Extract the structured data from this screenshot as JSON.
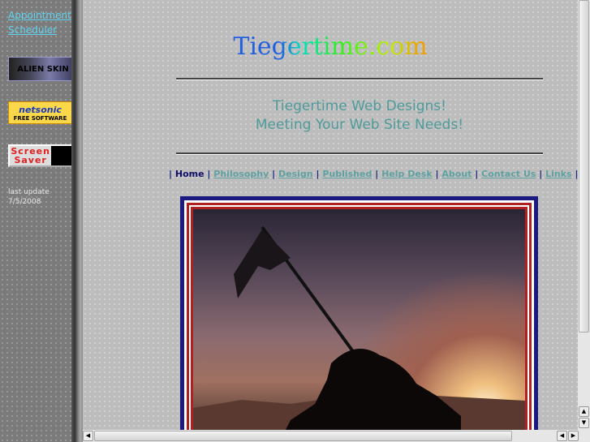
{
  "sidebar": {
    "appointment_link": "Appointment Scheduler",
    "alien_skin_label": "ALIEN SKIN",
    "netsonic_brand": "netsonic",
    "netsonic_sub": "FREE SOFTWARE",
    "screensaver_label": "Screen Saver",
    "last_update_label": "last update",
    "last_update_date": "7/5/2008"
  },
  "header": {
    "logo": "Tiegertime.com",
    "tagline1": "Tiegertime Web Designs!",
    "tagline2": "Meeting Your Web Site Needs!"
  },
  "nav": {
    "items": [
      "Home",
      "Philosophy",
      "Design",
      "Published",
      "Help Desk",
      "About",
      "Contact Us",
      "Links"
    ],
    "separator": "|"
  },
  "scrollbar": {
    "up": "▲",
    "down": "▼",
    "left": "◀",
    "right": "▶"
  }
}
